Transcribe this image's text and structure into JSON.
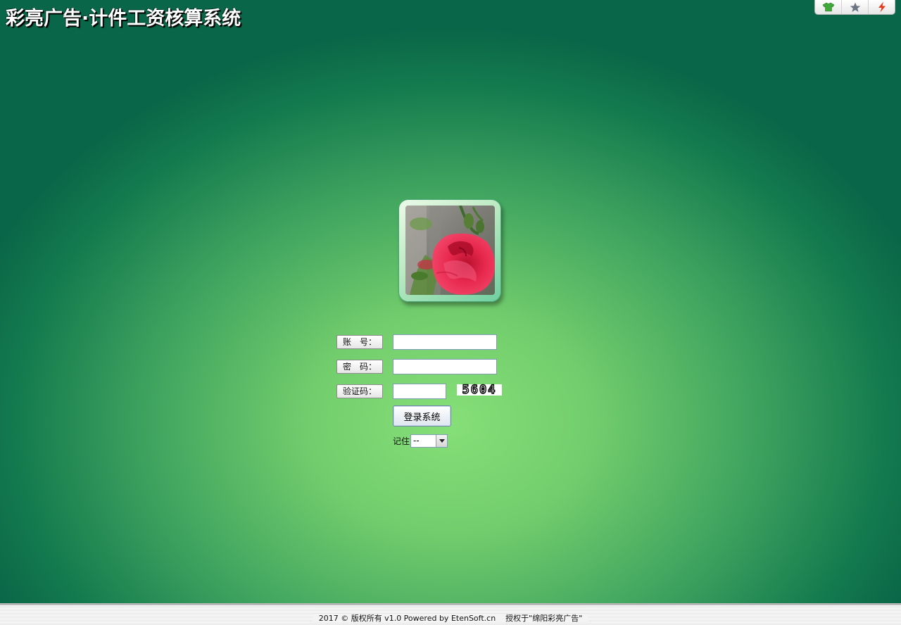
{
  "header": {
    "title": "彩亮广告·计件工资核算系统",
    "toolbar": [
      {
        "icon": "shirt-icon",
        "color": "#3aa23a"
      },
      {
        "icon": "star-icon",
        "color": "#6b7480"
      },
      {
        "icon": "lightning-icon",
        "color": "#e03a1c"
      }
    ]
  },
  "login": {
    "account_label": "账　号：",
    "account_value": "",
    "password_label": "密　码：",
    "password_value": "",
    "captcha_label": "验证码：",
    "captcha_value": "",
    "captcha_code": "5604",
    "submit_label": "登录系统",
    "remember_label": "记住",
    "remember_selected": "--"
  },
  "footer": {
    "copyright": "2017 © 版权所有 v1.0 Powered by EtenSoft.cn",
    "license": "授权于\"绵阳彩亮广告\""
  }
}
